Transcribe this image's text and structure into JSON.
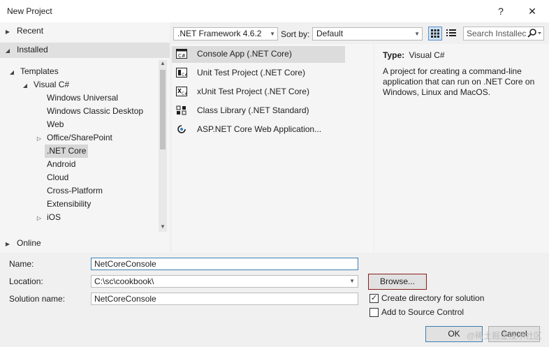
{
  "window": {
    "title": "New Project",
    "help_glyph": "?",
    "close_glyph": "✕"
  },
  "tree": {
    "recent": "Recent",
    "installed": "Installed",
    "templates": "Templates",
    "visual_csharp": "Visual C#",
    "children": [
      "Windows Universal",
      "Windows Classic Desktop",
      "Web",
      "Office/SharePoint",
      ".NET Core",
      "Android",
      "Cloud",
      "Cross-Platform",
      "Extensibility",
      "iOS"
    ],
    "online": "Online"
  },
  "toolbar": {
    "framework": ".NET Framework 4.6.2",
    "sort_label": "Sort by:",
    "sort_value": "Default",
    "search_placeholder": "Search Installec"
  },
  "templates": [
    {
      "label": "Console App (.NET Core)",
      "icon": "console-app-icon",
      "selected": true
    },
    {
      "label": "Unit Test Project (.NET Core)",
      "icon": "unit-test-icon",
      "selected": false
    },
    {
      "label": "xUnit Test Project (.NET Core)",
      "icon": "xunit-test-icon",
      "selected": false
    },
    {
      "label": "Class Library (.NET Standard)",
      "icon": "class-library-icon",
      "selected": false
    },
    {
      "label": "ASP.NET Core Web Application...",
      "icon": "aspnet-core-icon",
      "selected": false
    }
  ],
  "details": {
    "type_label": "Type:",
    "type_value": "Visual C#",
    "description": "A project for creating a command-line application that can run on .NET Core on Windows, Linux and MacOS."
  },
  "form": {
    "name_label": "Name:",
    "name_value": "NetCoreConsole",
    "location_label": "Location:",
    "location_value": "C:\\sc\\cookbook\\",
    "solution_label": "Solution name:",
    "solution_value": "NetCoreConsole",
    "browse_label": "Browse...",
    "create_dir_label": "Create directory for solution",
    "create_dir_checked": true,
    "source_control_label": "Add to Source Control",
    "source_control_checked": false,
    "ok_label": "OK",
    "cancel_label": "Cancel"
  },
  "watermark": "@稀土掘金技术社区",
  "colors": {
    "accent_border": "#8a1c1c",
    "focus_border": "#3c7fb1",
    "selection": "#dcdcdc"
  }
}
